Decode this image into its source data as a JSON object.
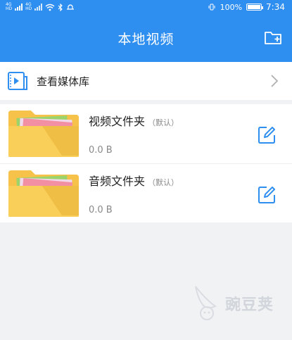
{
  "status_bar": {
    "battery": "100%",
    "time": "7:34",
    "battery_level": 1.0
  },
  "header": {
    "title": "本地视频"
  },
  "media_library": {
    "label": "查看媒体库"
  },
  "folders": [
    {
      "name": "视频文件夹",
      "tag": "（默认）",
      "size": "0.0 B"
    },
    {
      "name": "音频文件夹",
      "tag": "（默认）",
      "size": "0.0 B"
    }
  ],
  "watermark": {
    "text": "豌豆荚"
  },
  "colors": {
    "primary": "#2f8ff0",
    "folder_yellow": "#f9c74f",
    "icon_blue": "#2f8ff0"
  }
}
